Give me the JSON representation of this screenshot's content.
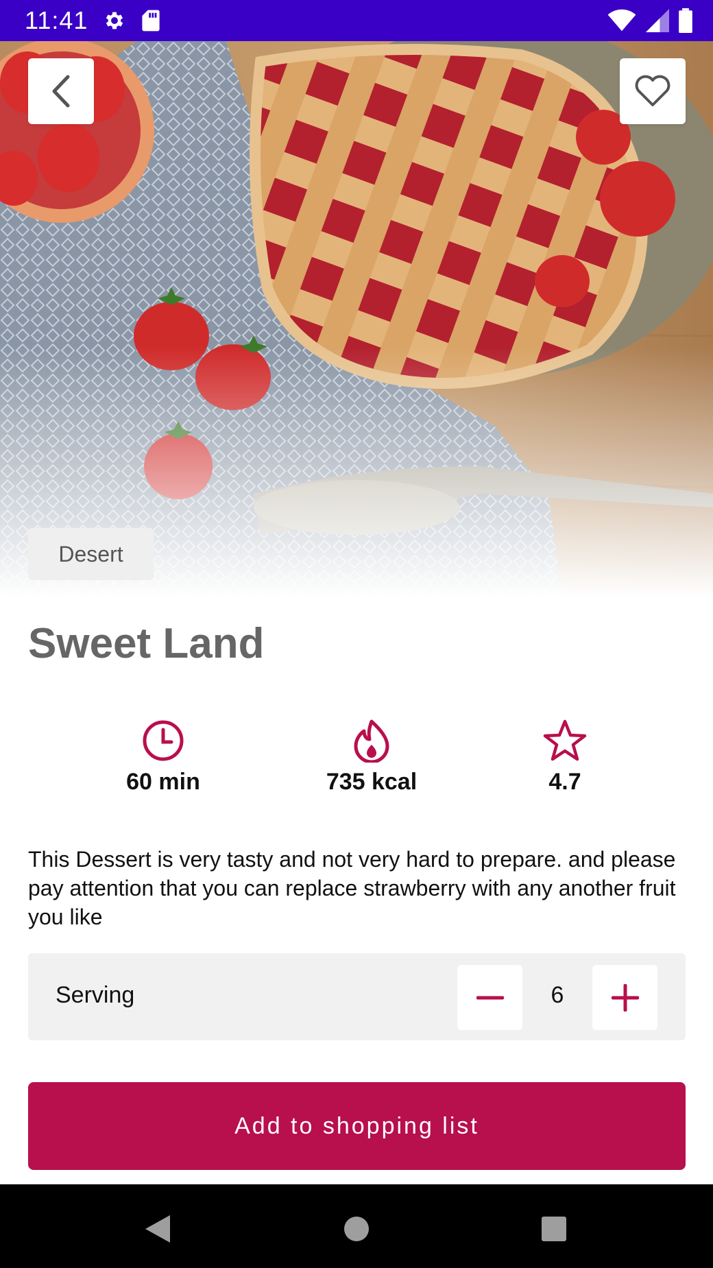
{
  "status_bar": {
    "time": "11:41",
    "left_icons": [
      "settings-icon",
      "sd-card-icon"
    ],
    "right_icons": [
      "wifi-icon",
      "signal-icon",
      "battery-icon"
    ],
    "color": "#3a00c6"
  },
  "header": {
    "back_icon": "chevron-left-icon",
    "favorite_icon": "heart-outline-icon"
  },
  "recipe": {
    "category": "Desert",
    "title": "Sweet Land",
    "stats": {
      "time": "60 min",
      "calories": "735 kcal",
      "rating": "4.7"
    },
    "description": "This Dessert is very tasty and not very hard to prepare. and please pay attention that you can replace strawberry with any another fruit you like"
  },
  "serving": {
    "label": "Serving",
    "count": "6"
  },
  "actions": {
    "add_to_list_label": "Add to shopping list"
  },
  "colors": {
    "accent": "#b80f4d",
    "status_bar": "#3a00c6"
  }
}
